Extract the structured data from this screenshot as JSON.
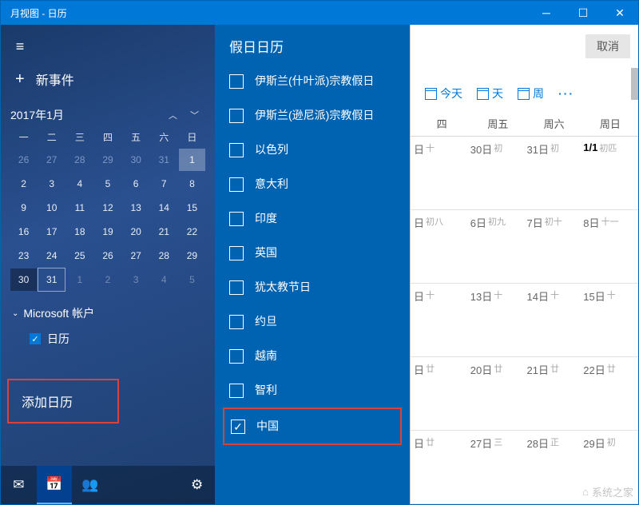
{
  "window": {
    "title": "月视图 - 日历"
  },
  "sidebar": {
    "new_event": "新事件",
    "month_label": "2017年1月",
    "weekdays": [
      "一",
      "二",
      "三",
      "四",
      "五",
      "六",
      "日"
    ],
    "grid": [
      [
        {
          "n": "26",
          "c": "dim2"
        },
        {
          "n": "27",
          "c": "dim2"
        },
        {
          "n": "28",
          "c": "dim2"
        },
        {
          "n": "29",
          "c": "dim2"
        },
        {
          "n": "30",
          "c": "dim2"
        },
        {
          "n": "31",
          "c": "dim2"
        },
        {
          "n": "1",
          "c": "today"
        }
      ],
      [
        {
          "n": "2",
          "c": ""
        },
        {
          "n": "3",
          "c": ""
        },
        {
          "n": "4",
          "c": ""
        },
        {
          "n": "5",
          "c": ""
        },
        {
          "n": "6",
          "c": ""
        },
        {
          "n": "7",
          "c": ""
        },
        {
          "n": "8",
          "c": ""
        }
      ],
      [
        {
          "n": "9",
          "c": ""
        },
        {
          "n": "10",
          "c": ""
        },
        {
          "n": "11",
          "c": ""
        },
        {
          "n": "12",
          "c": ""
        },
        {
          "n": "13",
          "c": ""
        },
        {
          "n": "14",
          "c": ""
        },
        {
          "n": "15",
          "c": ""
        }
      ],
      [
        {
          "n": "16",
          "c": ""
        },
        {
          "n": "17",
          "c": ""
        },
        {
          "n": "18",
          "c": ""
        },
        {
          "n": "19",
          "c": ""
        },
        {
          "n": "20",
          "c": ""
        },
        {
          "n": "21",
          "c": ""
        },
        {
          "n": "22",
          "c": ""
        }
      ],
      [
        {
          "n": "23",
          "c": ""
        },
        {
          "n": "24",
          "c": ""
        },
        {
          "n": "25",
          "c": ""
        },
        {
          "n": "26",
          "c": ""
        },
        {
          "n": "27",
          "c": ""
        },
        {
          "n": "28",
          "c": ""
        },
        {
          "n": "29",
          "c": ""
        }
      ],
      [
        {
          "n": "30",
          "c": "sel"
        },
        {
          "n": "31",
          "c": "selbox"
        },
        {
          "n": "1",
          "c": "dim"
        },
        {
          "n": "2",
          "c": "dim"
        },
        {
          "n": "3",
          "c": "dim"
        },
        {
          "n": "4",
          "c": "dim"
        },
        {
          "n": "5",
          "c": "dim"
        }
      ]
    ],
    "account_header": "Microsoft 帐户",
    "account_item": "日历",
    "add_calendar": "添加日历"
  },
  "holiday": {
    "title": "假日日历",
    "items": [
      {
        "label": "伊斯兰(什叶派)宗教假日",
        "checked": false,
        "hl": false
      },
      {
        "label": "伊斯兰(逊尼派)宗教假日",
        "checked": false,
        "hl": false
      },
      {
        "label": "以色列",
        "checked": false,
        "hl": false
      },
      {
        "label": "意大利",
        "checked": false,
        "hl": false
      },
      {
        "label": "印度",
        "checked": false,
        "hl": false
      },
      {
        "label": "英国",
        "checked": false,
        "hl": false
      },
      {
        "label": "犹太教节日",
        "checked": false,
        "hl": false
      },
      {
        "label": "约旦",
        "checked": false,
        "hl": false
      },
      {
        "label": "越南",
        "checked": false,
        "hl": false
      },
      {
        "label": "智利",
        "checked": false,
        "hl": false
      },
      {
        "label": "中国",
        "checked": true,
        "hl": true
      }
    ]
  },
  "content": {
    "cancel": "取消",
    "toolbar": {
      "today": "今天",
      "day": "天",
      "week": "周"
    },
    "dow": [
      "四",
      "周五",
      "周六",
      "周日"
    ],
    "weeks": [
      [
        {
          "d": "日",
          "t": "十"
        },
        {
          "d": "30日",
          "t": "初"
        },
        {
          "d": "31日",
          "t": "初"
        },
        {
          "d": "1/1",
          "t": "初匹",
          "today": true
        }
      ],
      [
        {
          "d": "日",
          "t": "初八"
        },
        {
          "d": "6日",
          "t": "初九"
        },
        {
          "d": "7日",
          "t": "初十"
        },
        {
          "d": "8日",
          "t": "十一"
        }
      ],
      [
        {
          "d": "日",
          "t": "十"
        },
        {
          "d": "13日",
          "t": "十"
        },
        {
          "d": "14日",
          "t": "十"
        },
        {
          "d": "15日",
          "t": "十"
        }
      ],
      [
        {
          "d": "日",
          "t": "廿"
        },
        {
          "d": "20日",
          "t": "廿"
        },
        {
          "d": "21日",
          "t": "廿"
        },
        {
          "d": "22日",
          "t": "廿"
        }
      ],
      [
        {
          "d": "日",
          "t": "廿"
        },
        {
          "d": "27日",
          "t": "三"
        },
        {
          "d": "28日",
          "t": "正"
        },
        {
          "d": "29日",
          "t": "初"
        }
      ]
    ],
    "watermark": "系统之家"
  }
}
